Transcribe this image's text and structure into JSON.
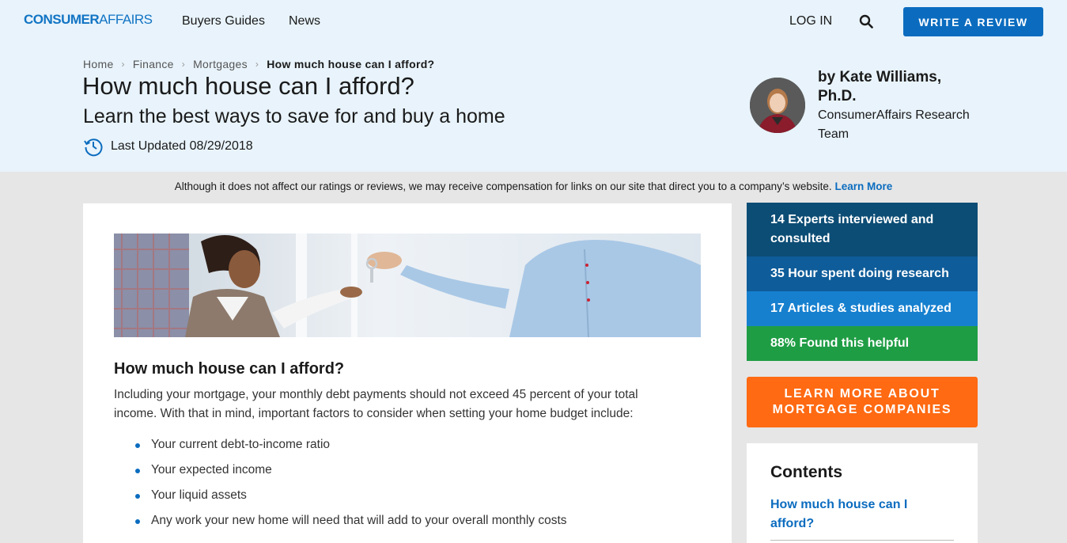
{
  "header": {
    "logo_bold": "CONSUMER",
    "logo_thin": "AFFAIRS",
    "nav": [
      "Buyers Guides",
      "News"
    ],
    "login": "LOG IN",
    "search_icon": "search-icon",
    "write_review": "WRITE A REVIEW"
  },
  "breadcrumb": [
    "Home",
    "Finance",
    "Mortgages",
    "How much house can I afford?"
  ],
  "article_header": {
    "title": "How much house can I afford?",
    "subtitle": "Learn the best ways to save for and buy a home",
    "updated": "Last Updated 08/29/2018"
  },
  "author": {
    "name": "by Kate Williams, Ph.D.",
    "team": "ConsumerAffairs Research Team"
  },
  "disclaimer": {
    "text": "Although it does not affect our ratings or reviews, we may receive compensation for links on our site that direct you to a company’s website.",
    "link": "Learn More"
  },
  "article": {
    "heading": "How much house can I afford?",
    "paragraph": "Including your mortgage, your monthly debt payments should not exceed 45 percent of your total income. With that in mind, important factors to consider when setting your home budget include:",
    "bullets": [
      "Your current debt-to-income ratio",
      "Your expected income",
      "Your liquid assets",
      "Any work your new home will need that will add to your overall monthly costs"
    ]
  },
  "stats": [
    "14 Experts interviewed and consulted",
    "35 Hour spent doing research",
    "17 Articles & studies analyzed",
    "88% Found this helpful"
  ],
  "cta": {
    "line1": "LEARN MORE ABOUT",
    "line2": "MORTGAGE COMPANIES"
  },
  "contents": {
    "title": "Contents",
    "items": [
      "How much house can I afford?"
    ]
  },
  "colors": {
    "brand_blue": "#0b6cbf",
    "cta_orange": "#ff6a13",
    "stat_green": "#1f9d45"
  }
}
